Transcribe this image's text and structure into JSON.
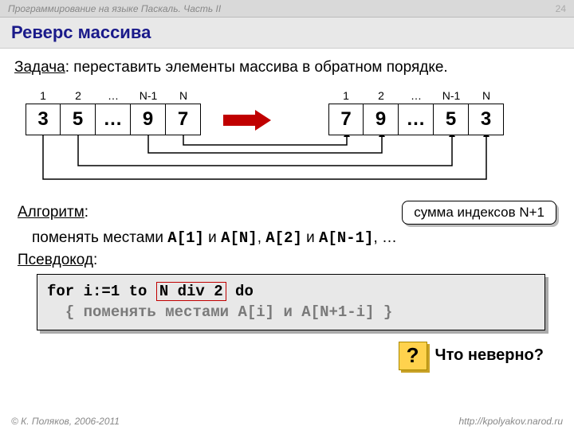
{
  "header": {
    "course": "Программирование на языке Паскаль. Часть II",
    "page": "24"
  },
  "title": "Реверс массива",
  "task": {
    "label": "Задача",
    "text": ": переставить элементы массива в обратном порядке."
  },
  "arr": {
    "labels": [
      "1",
      "2",
      "…",
      "N-1",
      "N"
    ],
    "left": [
      "3",
      "5",
      "…",
      "9",
      "7"
    ],
    "right": [
      "7",
      "9",
      "…",
      "5",
      "3"
    ]
  },
  "algoritm": "Алгоритм",
  "badge": "сумма индексов N+1",
  "swap": {
    "pre": "поменять местами ",
    "a1": "A[1]",
    "and1": " и ",
    "an": "A[N]",
    "c1": ", ",
    "a2": "A[2]",
    "and2": " и ",
    "an1": "A[N-1]",
    "tail": ", …"
  },
  "pseudo": "Псевдокод",
  "code": {
    "l1a": "for i:=1 to ",
    "l1h": "N div 2",
    "l1b": " do",
    "l2": "{ поменять местами A[i] и A[N+1-i] }"
  },
  "q": {
    "mark": "?",
    "text": "Что неверно?"
  },
  "footer": {
    "left": "© К. Поляков, 2006-2011",
    "right": "http://kpolyakov.narod.ru"
  }
}
